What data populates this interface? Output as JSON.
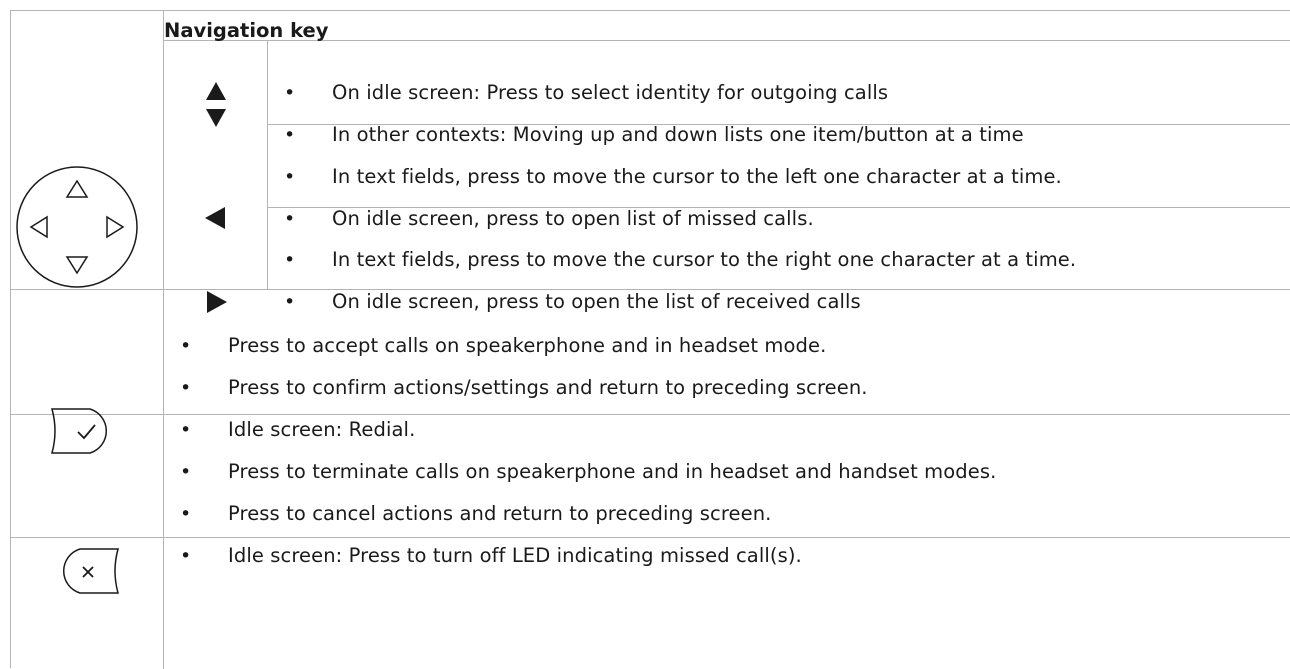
{
  "navigation": {
    "heading": "Navigation key",
    "up_down": [
      "On idle screen:  Press to select identity for outgoing calls",
      "In other contexts:  Moving up and down lists one item/button at a time"
    ],
    "left": [
      "In text fields, press to move the cursor to the left one character at a time.",
      "On idle screen, press to open list of missed calls."
    ],
    "right": [
      "In text fields, press to move the cursor to the right one character at a time.",
      "On idle screen, press to open the list of received calls"
    ]
  },
  "accept_key": {
    "items": [
      "Press to accept calls on speakerphone and in headset mode.",
      "Press to confirm actions/settings and return to preceding screen.",
      "Idle screen:  Redial."
    ]
  },
  "cancel_key": {
    "items": [
      "Press to terminate calls on speakerphone and in headset and handset modes.",
      "Press to cancel actions and return to preceding screen.",
      "Idle screen:  Press to turn off LED indicating missed call(s)."
    ]
  },
  "bullet_symbol": "•",
  "icons": {
    "nav": "navigation-key-icon",
    "up": "arrow-up-icon",
    "down": "arrow-down-icon",
    "left": "arrow-left-icon",
    "right": "arrow-right-icon",
    "accept": "accept-check-key-icon",
    "cancel": "cancel-x-key-icon"
  },
  "colors": {
    "grid": "#b4b4b4",
    "text": "#1a1a1a"
  }
}
